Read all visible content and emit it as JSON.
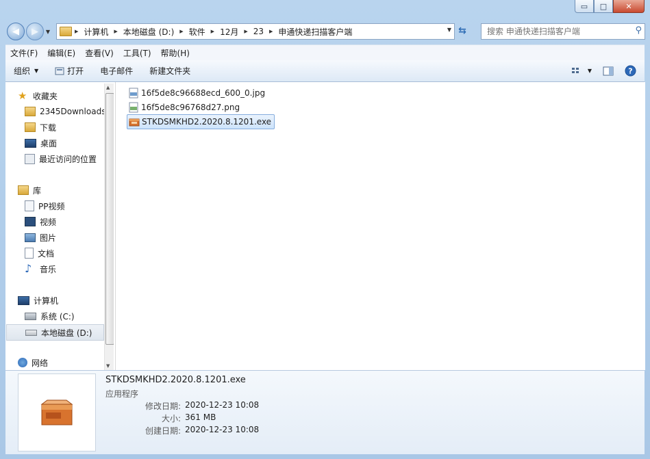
{
  "window": {
    "controls": {
      "minimize": "▭",
      "maximize": "□",
      "close": "✕"
    }
  },
  "address": {
    "crumbs": [
      "计算机",
      "本地磁盘 (D:)",
      "软件",
      "12月",
      "23",
      "申通快递扫描客户端"
    ],
    "search_placeholder": "搜索 申通快递扫描客户端"
  },
  "menu": [
    "文件(F)",
    "编辑(E)",
    "查看(V)",
    "工具(T)",
    "帮助(H)"
  ],
  "commands": {
    "organize": "组织",
    "open": "打开",
    "email": "电子邮件",
    "new_folder": "新建文件夹"
  },
  "nav": {
    "favorites": "收藏夹",
    "downloads2345": "2345Downloads",
    "downloads": "下载",
    "desktop": "桌面",
    "recent": "最近访问的位置",
    "libraries": "库",
    "pp_video": "PP视频",
    "videos": "视频",
    "pictures": "图片",
    "documents": "文档",
    "music": "音乐",
    "computer": "计算机",
    "drive_c": "系统 (C:)",
    "drive_d": "本地磁盘 (D:)",
    "network": "网络"
  },
  "files": [
    {
      "name": "16f5de8c96688ecd_600_0.jpg",
      "icon": "jpg-file-icon"
    },
    {
      "name": "16f5de8c96768d27.png",
      "icon": "png-file-icon"
    },
    {
      "name": "STKDSMKHD2.2020.8.1201.exe",
      "icon": "exe-box-icon",
      "selected": true
    }
  ],
  "details": {
    "name": "STKDSMKHD2.2020.8.1201.exe",
    "type": "应用程序",
    "modified_label": "修改日期:",
    "modified": "2020-12-23 10:08",
    "size_label": "大小:",
    "size": "361 MB",
    "created_label": "创建日期:",
    "created": "2020-12-23 10:08"
  }
}
